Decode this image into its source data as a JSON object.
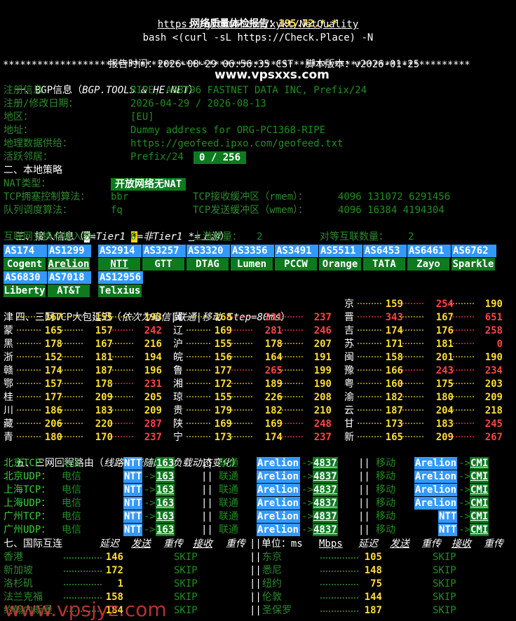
{
  "header": {
    "title": "网络质量体检报告：",
    "ip": "195.72.*.*",
    "repo_url": "https://github.com/xykt/NetQuality",
    "command": "bash <(curl -sL https://Check.Place) -N",
    "report_time_label": "报告时间：",
    "report_time": "2026-08-29 06:56:35 CST",
    "version_label": "脚本版本：",
    "version": "v2026-01-25"
  },
  "separator": "**********************************************************************************",
  "bgp": {
    "section": "一、BGP信息（",
    "section_italic": "BGP.TOOLS & HE.NET",
    "section_end": "）",
    "watermark": "www.vpsxxs.com",
    "rows": [
      {
        "label": "注册信息：",
        "value": "RIPE, AS8796 FASTNET DATA INC, Prefix/24"
      },
      {
        "label": "注册/修改日期：",
        "value": "2026-04-29 / 2026-08-13"
      },
      {
        "label": "地区：",
        "value": "[EU]"
      },
      {
        "label": "地址：",
        "value": "Dummy address for ORG-PC1368-RIPE"
      },
      {
        "label": "地理数据供给：",
        "value": "https://geofeed.ipxo.com/geofeed.txt"
      },
      {
        "label": "活跃邻居：",
        "value": "Prefix/24",
        "badge": "0 / 256"
      }
    ]
  },
  "local": {
    "section": "二、本地策略",
    "nat_label": "NAT类型：",
    "nat_value": "开放网络无NAT",
    "cc_label": "TCP拥塞控制算法：",
    "cc_value": "bbr",
    "rmem_label": "TCP接收缓冲区（rmem）：",
    "rmem_value": "4096 131072 6291456",
    "qdisc_label": "队列调度算法：",
    "qdisc_value": "fq",
    "wmem_label": "TCP发送缓冲区（wmem）：",
    "wmem_value": "4096 16384 4194304"
  },
  "access": {
    "section": "三、接入信息（",
    "legend": [
      {
        "sym": "*",
        "text": "=Tier1 "
      },
      {
        "sym": "*",
        "text": "=非Tier1 "
      },
      {
        "sym": "*",
        "text": "=上游"
      }
    ],
    "section_end": "）",
    "ix_label": "互联网交换点接入数：",
    "ix_value": "0",
    "upstream_label": "上游数量：",
    "upstream_value": "2",
    "peer_label": "对等互联数量：",
    "peer_value": "2",
    "as_rows": [
      [
        {
          "as": "AS174",
          "name": "Cogent"
        },
        {
          "as": "AS1299",
          "name": "Arelion"
        },
        {
          "as": "AS2914",
          "name": "NTT"
        },
        {
          "as": "AS3257",
          "name": "GTT"
        },
        {
          "as": "AS3320",
          "name": "DTAG"
        },
        {
          "as": "AS3356",
          "name": "Lumen"
        },
        {
          "as": "AS3491",
          "name": "PCCW"
        },
        {
          "as": "AS5511",
          "name": "Orange"
        },
        {
          "as": "AS6453",
          "name": "TATA"
        },
        {
          "as": "AS6461",
          "name": "Zayo"
        },
        {
          "as": "AS6762",
          "name": "Sparkle"
        }
      ],
      [
        {
          "as": "AS6830",
          "name": "Liberty"
        },
        {
          "as": "AS7018",
          "name": "AT&T"
        },
        {
          "as": "AS12956",
          "name": "Telxius"
        }
      ]
    ]
  },
  "latency": {
    "section": "四、三网TCP大包延迟（",
    "section_italic": "依次为电信|联通|移动 Step=80ms",
    "section_end": "）",
    "rows": [
      [
        {
          "p": "京",
          "v": [
            "159",
            "254",
            "190"
          ]
        }
      ],
      [
        {
          "p": "津",
          "v": [
            "167",
            "155",
            "193"
          ]
        },
        {
          "p": "冀",
          "v": [
            "168",
            "231",
            "237"
          ]
        },
        {
          "p": "晋",
          "v": [
            "343",
            "167",
            "651"
          ]
        }
      ],
      [
        {
          "p": "蒙",
          "v": [
            "165",
            "157",
            "242"
          ]
        },
        {
          "p": "辽",
          "v": [
            "169",
            "281",
            "246"
          ]
        },
        {
          "p": "吉",
          "v": [
            "174",
            "176",
            "258"
          ]
        }
      ],
      [
        {
          "p": "黑",
          "v": [
            "178",
            "167",
            "216"
          ]
        },
        {
          "p": "沪",
          "v": [
            "155",
            "178",
            "207"
          ]
        },
        {
          "p": "苏",
          "v": [
            "171",
            "181",
            "0"
          ]
        }
      ],
      [
        {
          "p": "浙",
          "v": [
            "152",
            "181",
            "194"
          ]
        },
        {
          "p": "皖",
          "v": [
            "156",
            "164",
            "191"
          ]
        },
        {
          "p": "闽",
          "v": [
            "158",
            "201",
            "190"
          ]
        }
      ],
      [
        {
          "p": "赣",
          "v": [
            "174",
            "187",
            "196"
          ]
        },
        {
          "p": "鲁",
          "v": [
            "177",
            "265",
            "199"
          ]
        },
        {
          "p": "豫",
          "v": [
            "166",
            "243",
            "234"
          ]
        }
      ],
      [
        {
          "p": "鄂",
          "v": [
            "157",
            "178",
            "231"
          ]
        },
        {
          "p": "湘",
          "v": [
            "172",
            "189",
            "190"
          ]
        },
        {
          "p": "粤",
          "v": [
            "160",
            "175",
            "203"
          ]
        }
      ],
      [
        {
          "p": "桂",
          "v": [
            "177",
            "209",
            "205"
          ]
        },
        {
          "p": "琼",
          "v": [
            "155",
            "226",
            "208"
          ]
        },
        {
          "p": "渝",
          "v": [
            "182",
            "180",
            "209"
          ]
        }
      ],
      [
        {
          "p": "川",
          "v": [
            "186",
            "183",
            "209"
          ]
        },
        {
          "p": "贵",
          "v": [
            "179",
            "182",
            "210"
          ]
        },
        {
          "p": "云",
          "v": [
            "187",
            "204",
            "218"
          ]
        }
      ],
      [
        {
          "p": "藏",
          "v": [
            "206",
            "220",
            "287"
          ]
        },
        {
          "p": "陕",
          "v": [
            "169",
            "169",
            "248"
          ]
        },
        {
          "p": "甘",
          "v": [
            "173",
            "183",
            "245"
          ]
        }
      ],
      [
        {
          "p": "青",
          "v": [
            "180",
            "170",
            "237"
          ]
        },
        {
          "p": "宁",
          "v": [
            "173",
            "174",
            "237"
          ]
        },
        {
          "p": "新",
          "v": [
            "165",
            "209",
            "267"
          ]
        }
      ]
    ]
  },
  "routes": {
    "section": "五、三网回程路由（",
    "section_italic": "线路可能随网络负载动态变化",
    "section_end": "）",
    "rows": [
      {
        "label": "北京TCP：",
        "ct": [
          "NTT",
          "163"
        ],
        "cu": [
          "Arelion",
          "4837"
        ],
        "cm": [
          "Arelion",
          "CMI"
        ]
      },
      {
        "label": "北京UDP：",
        "ct": [
          "NTT",
          "163"
        ],
        "cu": [
          "Arelion",
          "4837"
        ],
        "cm": [
          "Arelion",
          "CMI"
        ]
      },
      {
        "label": "上海TCP：",
        "ct": [
          "NTT",
          "163"
        ],
        "cu": [
          "Arelion",
          "4837"
        ],
        "cm": [
          "Arelion",
          "CMI"
        ]
      },
      {
        "label": "上海UDP：",
        "ct": [
          "NTT",
          "163"
        ],
        "cu": [
          "Arelion",
          "4837"
        ],
        "cm": [
          "Arelion",
          "CMI"
        ]
      },
      {
        "label": "广州TCP：",
        "ct": [
          "NTT",
          "163"
        ],
        "cu": [
          "Arelion",
          "4837"
        ],
        "cm": [
          "NTT",
          "CMI"
        ]
      },
      {
        "label": "广州UDP：",
        "ct": [
          "NTT",
          "163"
        ],
        "cu": [
          "Arelion",
          "4837"
        ],
        "cm": [
          "NTT",
          "CMI"
        ]
      }
    ],
    "ct_label": "电信",
    "cu_label": "联通",
    "cm_label": "移动",
    "sep": "||"
  },
  "intl": {
    "section": "七、国际互连",
    "cols_left": [
      "延迟",
      "发送",
      "重传",
      "接收",
      "重传"
    ],
    "unit_label": "||单位：ms",
    "unit_mbps": "Mbps",
    "cols_right": [
      "延迟",
      "发送",
      "重传",
      "接收",
      "重传"
    ],
    "rows": [
      {
        "l": {
          "city": "香港",
          "lat": "146",
          "st": "SKIP"
        },
        "r": {
          "city": "东京",
          "lat": "105",
          "st": "SKIP"
        }
      },
      {
        "l": {
          "city": "新加坡",
          "lat": "172",
          "st": "SKIP"
        },
        "r": {
          "city": "悉尼",
          "lat": "148",
          "st": "SKIP"
        }
      },
      {
        "l": {
          "city": "洛杉矶",
          "lat": "1",
          "st": "SKIP"
        },
        "r": {
          "city": "纽约",
          "lat": "75",
          "st": "SKIP"
        }
      },
      {
        "l": {
          "city": "法兰克福",
          "lat": "158",
          "st": "SKIP"
        },
        "r": {
          "city": "伦敦",
          "lat": "144",
          "st": "SKIP"
        }
      },
      {
        "l": {
          "city": "约翰内斯堡",
          "lat": "184",
          "st": "SKIP"
        },
        "r": {
          "city": "圣保罗",
          "lat": "187",
          "st": "SKIP"
        }
      }
    ]
  },
  "bottom_watermark": "www.vpsjyz.com"
}
